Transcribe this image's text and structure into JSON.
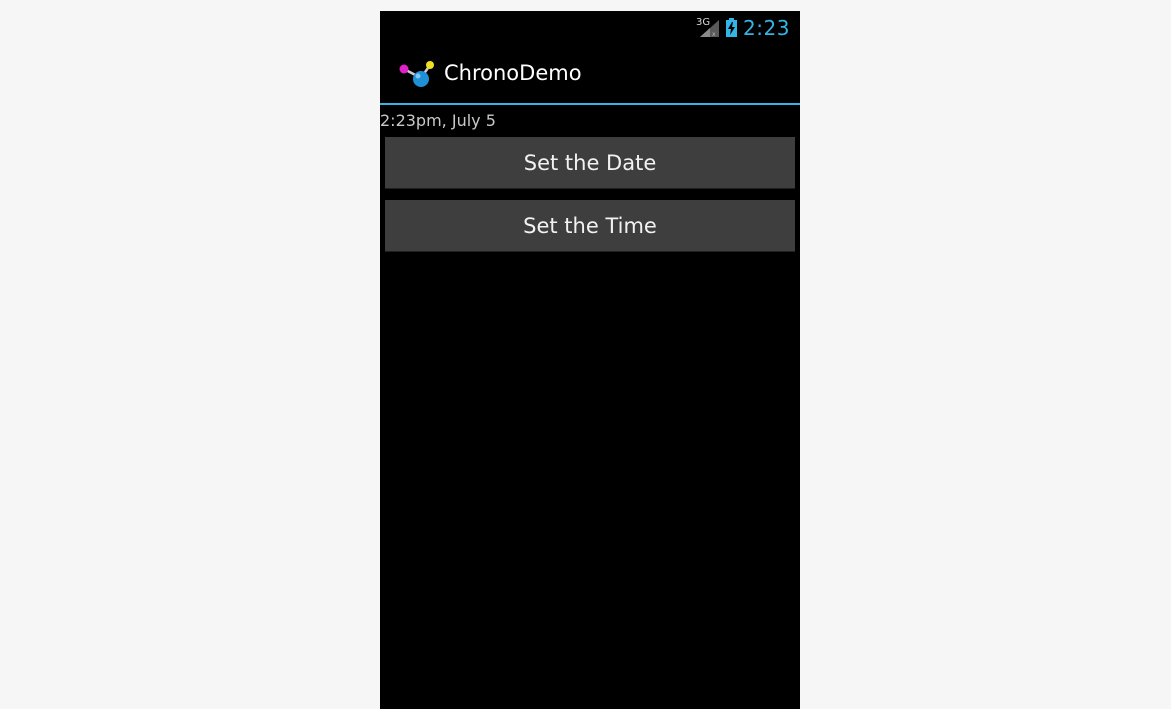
{
  "status_bar": {
    "network_label": "3G",
    "time": "2:23",
    "accent_color": "#33b5e5"
  },
  "action_bar": {
    "title": "ChronoDemo",
    "icon": "molecule-app-icon"
  },
  "content": {
    "date_time_text": "2:23pm, July 5",
    "buttons": {
      "set_date_label": "Set the Date",
      "set_time_label": "Set the Time"
    }
  },
  "colors": {
    "background": "#f6f6f6",
    "screen": "#000000",
    "button": "#3e3e3e",
    "accent": "#33b5e5"
  }
}
